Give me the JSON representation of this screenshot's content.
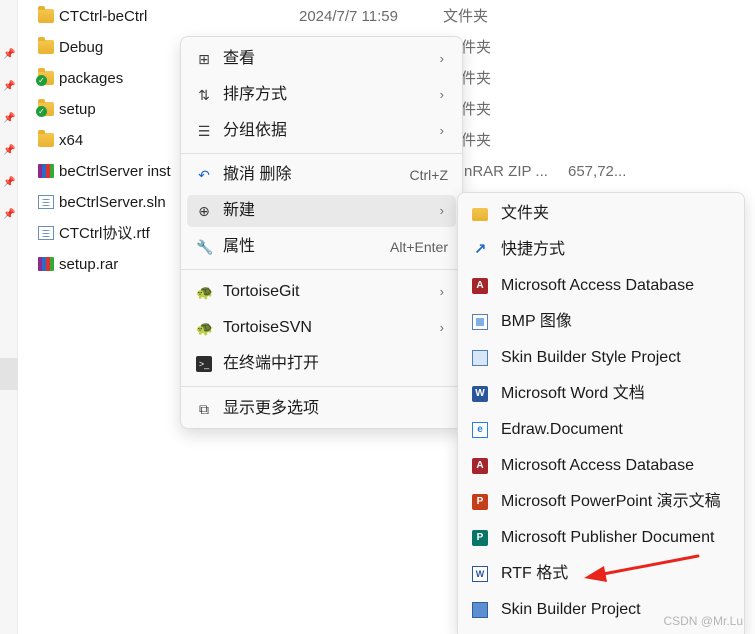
{
  "files": [
    {
      "name": "CTCtrl-beCtrl",
      "date": "2024/7/7 11:59",
      "type": "文件夹",
      "size": "",
      "icon": "folder-icon"
    },
    {
      "name": "Debug",
      "date": "",
      "type": "件夹",
      "size": "",
      "icon": "folder-icon"
    },
    {
      "name": "packages",
      "date": "",
      "type": "件夹",
      "size": "",
      "icon": "folder-sync-icon"
    },
    {
      "name": "setup",
      "date": "",
      "type": "件夹",
      "size": "",
      "icon": "folder-sync-icon"
    },
    {
      "name": "x64",
      "date": "",
      "type": "件夹",
      "size": "",
      "icon": "folder-icon"
    },
    {
      "name": "beCtrlServer inst",
      "date": "",
      "type": "nRAR ZIP ...",
      "size": "657,72...",
      "icon": "rar-archive-icon"
    },
    {
      "name": "beCtrlServer.sln",
      "date": "",
      "type": "",
      "size": "",
      "icon": "solution-file-icon"
    },
    {
      "name": "CTCtrl协议.rtf",
      "date": "",
      "type": "",
      "size": "",
      "icon": "rtf-file-icon"
    },
    {
      "name": "setup.rar",
      "date": "",
      "type": "",
      "size": "",
      "icon": "rar-archive-icon"
    }
  ],
  "menu": {
    "view": "查看",
    "sort": "排序方式",
    "group": "分组依据",
    "undo": "撤消 删除",
    "undo_key": "Ctrl+Z",
    "new": "新建",
    "properties": "属性",
    "properties_key": "Alt+Enter",
    "tortoisegit": "TortoiseGit",
    "tortoisesvn": "TortoiseSVN",
    "terminal": "在终端中打开",
    "more": "显示更多选项"
  },
  "submenu": [
    {
      "label": "文件夹",
      "icon": "folder-icon"
    },
    {
      "label": "快捷方式",
      "icon": "shortcut-icon"
    },
    {
      "label": "Microsoft Access Database",
      "icon": "access-icon"
    },
    {
      "label": "BMP 图像",
      "icon": "bmp-image-icon"
    },
    {
      "label": "Skin Builder Style Project",
      "icon": "skin-builder-icon"
    },
    {
      "label": "Microsoft Word 文档",
      "icon": "word-icon"
    },
    {
      "label": "Edraw.Document",
      "icon": "edraw-icon"
    },
    {
      "label": "Microsoft Access Database",
      "icon": "access-icon"
    },
    {
      "label": "Microsoft PowerPoint 演示文稿",
      "icon": "powerpoint-icon"
    },
    {
      "label": "Microsoft Publisher Document",
      "icon": "publisher-icon"
    },
    {
      "label": "RTF 格式",
      "icon": "rtf-icon"
    },
    {
      "label": "Skin Builder Project",
      "icon": "skin-builder-project-icon"
    }
  ],
  "watermark": "CSDN @Mr.Lu",
  "colors": {
    "annotation_arrow": "#e8251c",
    "hover": "#e9e9e9",
    "menu_bg": "#f9f9f9"
  }
}
